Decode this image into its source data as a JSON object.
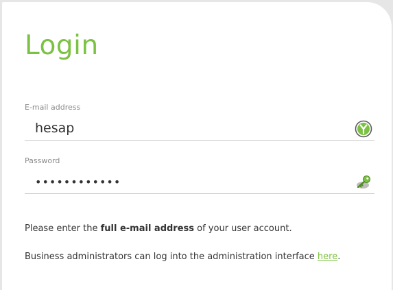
{
  "form": {
    "title": "Login",
    "email": {
      "label": "E-mail address",
      "value": "hesap",
      "icon": "identity-icon"
    },
    "password": {
      "label": "Password",
      "value": "••••••••••••",
      "icon": "key-icon"
    }
  },
  "help": {
    "line1_prefix": "Please enter the ",
    "line1_bold": "full e-mail address",
    "line1_suffix": " of your user account.",
    "line2_prefix": "Business administrators can log into the administration interface ",
    "line2_link": "here",
    "line2_suffix": "."
  },
  "colors": {
    "accent": "#7cc242",
    "background": "#e6e6e6",
    "panel": "#ffffff",
    "text": "#333333",
    "label": "#8a8a8a"
  }
}
